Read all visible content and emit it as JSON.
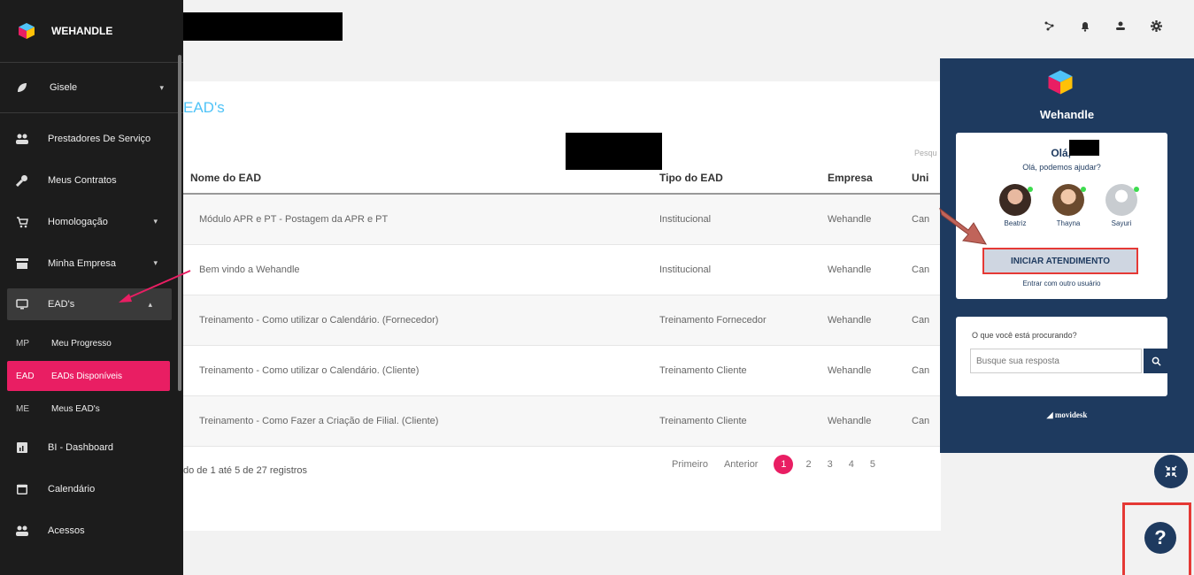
{
  "sidebar": {
    "brand": "WEHANDLE",
    "user": "Gisele",
    "items": [
      {
        "label": "Prestadores De Serviço"
      },
      {
        "label": "Meus Contratos"
      },
      {
        "label": "Homologação"
      },
      {
        "label": "Minha Empresa"
      },
      {
        "label": "EAD's"
      }
    ],
    "subitems": [
      {
        "abbr": "MP",
        "label": "Meu Progresso"
      },
      {
        "abbr": "EAD",
        "label": "EADs Disponíveis"
      },
      {
        "abbr": "ME",
        "label": "Meus EAD's"
      }
    ],
    "items2": [
      {
        "label": "BI - Dashboard"
      },
      {
        "label": "Calendário"
      },
      {
        "label": "Acessos"
      }
    ]
  },
  "main": {
    "title": "EAD's",
    "search_label": "Pesqu",
    "columns": [
      "Nome do EAD",
      "Tipo do EAD",
      "Empresa",
      "Uni"
    ],
    "rows": [
      [
        "Módulo APR e PT - Postagem da APR e PT",
        "Institucional",
        "Wehandle",
        "Can"
      ],
      [
        "Bem vindo a Wehandle",
        "Institucional",
        "Wehandle",
        "Can"
      ],
      [
        "Treinamento - Como utilizar o Calendário. (Fornecedor)",
        "Treinamento Fornecedor",
        "Wehandle",
        "Can"
      ],
      [
        "Treinamento - Como utilizar o Calendário. (Cliente)",
        "Treinamento Cliente",
        "Wehandle",
        "Can"
      ],
      [
        "Treinamento - Como Fazer a Criação de Filial. (Cliente)",
        "Treinamento Cliente",
        "Wehandle",
        "Can"
      ]
    ],
    "footer_info": "do de 1 até 5 de 27 registros",
    "pager": {
      "first": "Primeiro",
      "prev": "Anterior",
      "current": "1",
      "pages": [
        "2",
        "3",
        "4",
        "5"
      ]
    }
  },
  "widget": {
    "title": "Wehandle",
    "hello": "Olá,",
    "help_question": "Olá, podemos ajudar?",
    "agents": [
      {
        "name": "Beatriz"
      },
      {
        "name": "Thayna"
      },
      {
        "name": "Sayuri"
      }
    ],
    "start_button": "INICIAR ATENDIMENTO",
    "other_user": "Entrar com outro usuário",
    "search_question": "O que você está procurando?",
    "search_placeholder": "Busque sua resposta",
    "footer": "movidesk"
  },
  "colors": {
    "accent": "#e91e63",
    "widget_bg": "#1e3a5f",
    "title": "#4fc3f7",
    "highlight": "#e53935"
  },
  "help_glyph": "?"
}
